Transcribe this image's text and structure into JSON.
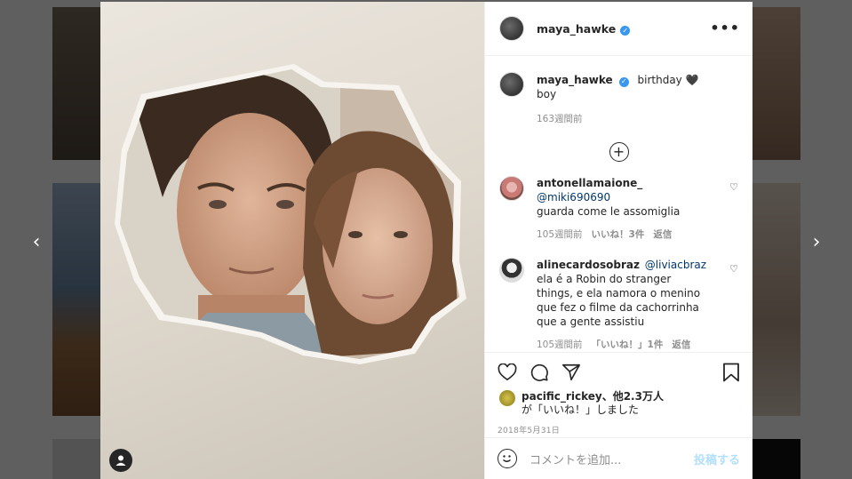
{
  "nav": {
    "prev_icon": "‹",
    "next_icon": "›"
  },
  "post": {
    "author": "maya_hawke",
    "caption_user": "maya_hawke",
    "caption_text": "birthday 🖤 boy",
    "caption_time": "163週間前",
    "more_icon": "•••"
  },
  "comments": [
    {
      "user": "antonellamaione_",
      "mention": "@miki690690",
      "text": "guarda come le assomiglia",
      "time": "105週間前",
      "likes": "いいね！3件",
      "reply": "返信"
    },
    {
      "user": "alinecardosobraz",
      "mention": "@liviacbraz",
      "text": "ela é a Robin do stranger things, e ela namora o menino que fez o filme da cachorrinha que a gente assistiu",
      "time": "105週間前",
      "likes": "「いいね！」1件",
      "reply": "返信"
    }
  ],
  "likes": {
    "first_user": "pacific_rickey",
    "others": "、他2.3万人",
    "suffix": "が「いいね！」しました"
  },
  "date": "2018年5月31日",
  "add_comment": {
    "placeholder": "コメントを追加...",
    "post_label": "投稿する"
  },
  "colors": {
    "verified": "#3897f0",
    "post_button": "#b2dffc",
    "mention": "#00376b"
  }
}
